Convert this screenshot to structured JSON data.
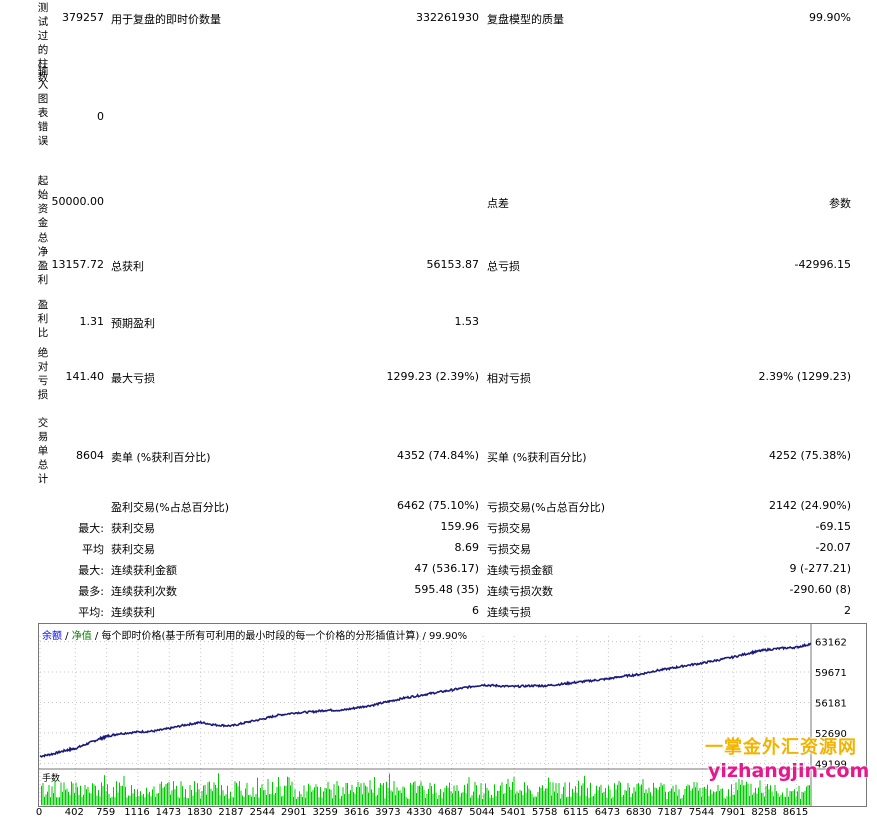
{
  "report": {
    "rows": [
      {
        "label": "测试过的柱数",
        "value": "379257",
        "l1": "用于复盘的即时价数量",
        "v1": "332261930",
        "l2": "复盘模型的质量",
        "v2": "99.90%"
      },
      {
        "label": "输入图表错误",
        "value": "0",
        "l1": "",
        "v1": "",
        "l2": "",
        "v2": ""
      },
      {
        "label": "起始资金",
        "value": "50000.00",
        "l1": "",
        "v1": "",
        "l2": "点差",
        "v2": "参数"
      },
      {
        "label": "总净盈利",
        "value": "13157.72",
        "l1": "总获利",
        "v1": "56153.87",
        "l2": "总亏损",
        "v2": "-42996.15"
      },
      {
        "label": "盈利比",
        "value": "1.31",
        "l1": "预期盈利",
        "v1": "1.53",
        "l2": "",
        "v2": ""
      },
      {
        "label": "绝对亏损",
        "value": "141.40",
        "l1": "最大亏损",
        "v1": "1299.23 (2.39%)",
        "l2": "相对亏损",
        "v2": "2.39% (1299.23)"
      },
      {
        "label": "交易单总计",
        "value": "8604",
        "l1": "卖单 (%获利百分比)",
        "v1": "4352 (74.84%)",
        "l2": "买单 (%获利百分比)",
        "v2": "4252 (75.38%)"
      }
    ],
    "stats": [
      {
        "prefix": "",
        "l1": "盈利交易(%占总百分比)",
        "v1": "6462 (75.10%)",
        "l2": "亏损交易(%占总百分比)",
        "v2": "2142 (24.90%)"
      },
      {
        "prefix": "最大:",
        "l1": "获利交易",
        "v1": "159.96",
        "l2": "亏损交易",
        "v2": "-69.15"
      },
      {
        "prefix": "平均",
        "l1": "获利交易",
        "v1": "8.69",
        "l2": "亏损交易",
        "v2": "-20.07"
      },
      {
        "prefix": "最大:",
        "l1": "连续获利金额",
        "v1": "47 (536.17)",
        "l2": "连续亏损金额",
        "v2": "9 (-277.21)"
      },
      {
        "prefix": "最多:",
        "l1": "连续获利次数",
        "v1": "595.48 (35)",
        "l2": "连续亏损次数",
        "v2": "-290.60 (8)"
      },
      {
        "prefix": "平均:",
        "l1": "连续获利",
        "v1": "6",
        "l2": "连续亏损",
        "v2": "2"
      }
    ]
  },
  "chart": {
    "header_balance": "余额",
    "header_sep1": " / ",
    "header_equity": "净值",
    "header_rest": " / 每个即时价格(基于所有可利用的最小时段的每一个价格的分形插值计算) / 99.90%",
    "sub_label": "手数",
    "colors": {
      "balance": "#0000ff",
      "equity": "#008000",
      "line": "#1a1a7a",
      "bars": "#00c800"
    }
  },
  "chart_data": {
    "type": "line",
    "title": "",
    "y_ticks": [
      63162,
      59671,
      56181,
      52690,
      49199
    ],
    "x_ticks": [
      0,
      402,
      759,
      1116,
      1473,
      1830,
      2187,
      2544,
      2901,
      3259,
      3616,
      3973,
      4330,
      4687,
      5044,
      5401,
      5758,
      6115,
      6473,
      6830,
      7187,
      7544,
      7901,
      8258,
      8615
    ],
    "ylim": [
      48900,
      63800
    ],
    "xlim": [
      0,
      8780
    ],
    "series": [
      {
        "values": [
          [
            0,
            50000
          ],
          [
            150,
            50300
          ],
          [
            300,
            50700
          ],
          [
            402,
            50900
          ],
          [
            550,
            51500
          ],
          [
            700,
            52100
          ],
          [
            759,
            52300
          ],
          [
            900,
            52600
          ],
          [
            1116,
            52800
          ],
          [
            1300,
            52900
          ],
          [
            1473,
            53200
          ],
          [
            1650,
            53600
          ],
          [
            1830,
            53900
          ],
          [
            2000,
            53600
          ],
          [
            2187,
            53500
          ],
          [
            2350,
            53900
          ],
          [
            2544,
            54300
          ],
          [
            2700,
            54700
          ],
          [
            2901,
            55000
          ],
          [
            3100,
            55100
          ],
          [
            3259,
            55300
          ],
          [
            3450,
            55300
          ],
          [
            3616,
            55600
          ],
          [
            3800,
            55900
          ],
          [
            3973,
            56300
          ],
          [
            4150,
            56700
          ],
          [
            4330,
            57000
          ],
          [
            4500,
            57300
          ],
          [
            4687,
            57600
          ],
          [
            4850,
            57900
          ],
          [
            5044,
            58200
          ],
          [
            5200,
            58100
          ],
          [
            5401,
            58000
          ],
          [
            5600,
            58100
          ],
          [
            5758,
            58100
          ],
          [
            5950,
            58300
          ],
          [
            6115,
            58500
          ],
          [
            6300,
            58700
          ],
          [
            6473,
            58900
          ],
          [
            6650,
            59200
          ],
          [
            6830,
            59400
          ],
          [
            7000,
            59800
          ],
          [
            7187,
            60100
          ],
          [
            7350,
            60400
          ],
          [
            7544,
            60700
          ],
          [
            7700,
            61000
          ],
          [
            7901,
            61400
          ],
          [
            8100,
            61900
          ],
          [
            8258,
            62200
          ],
          [
            8450,
            62400
          ],
          [
            8615,
            62500
          ],
          [
            8780,
            62900
          ]
        ]
      }
    ]
  },
  "watermark": {
    "cn": "一掌金外汇资源网",
    "url": "yizhangjin.com"
  }
}
